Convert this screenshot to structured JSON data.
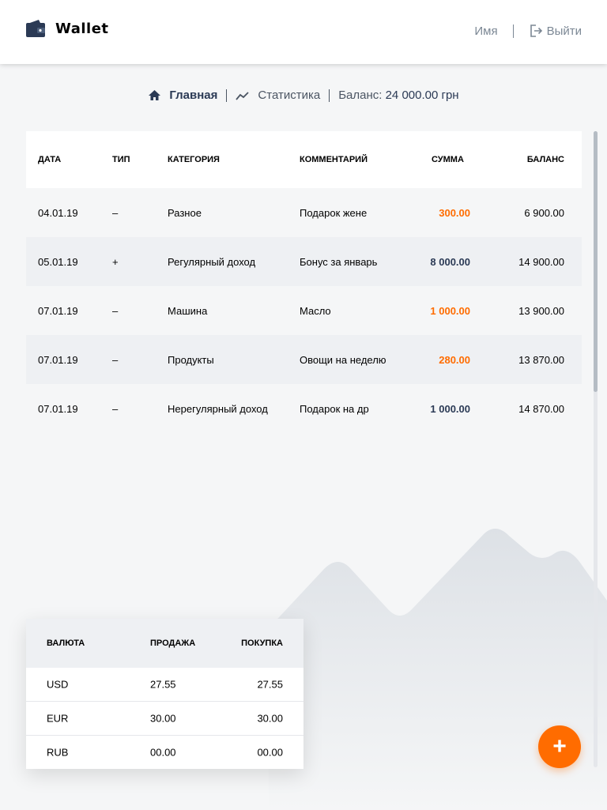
{
  "header": {
    "logo_text": "Wallet",
    "user_name": "Имя",
    "logout_label": "Выйти"
  },
  "nav": {
    "home_label": "Главная",
    "stats_label": "Статистика",
    "balance_label": "Баланс:",
    "balance_value": "24 000.00 грн"
  },
  "transactions": {
    "headers": [
      "Дата",
      "Тип",
      "Категория",
      "Комментарий",
      "Сумма",
      "Баланс"
    ],
    "rows": [
      {
        "date": "04.01.19",
        "type": "–",
        "category": "Разное",
        "comment": "Подарок жене",
        "sum": "300.00",
        "kind": "expense",
        "balance": "6 900.00"
      },
      {
        "date": "05.01.19",
        "type": "+",
        "category": "Регулярный доход",
        "comment": "Бонус за январь",
        "sum": "8 000.00",
        "kind": "income",
        "balance": "14 900.00"
      },
      {
        "date": "07.01.19",
        "type": "–",
        "category": "Машина",
        "comment": "Масло",
        "sum": "1 000.00",
        "kind": "expense",
        "balance": "13 900.00"
      },
      {
        "date": "07.01.19",
        "type": "–",
        "category": "Продукты",
        "comment": "Овощи на неделю",
        "sum": "280.00",
        "kind": "expense",
        "balance": "13 870.00"
      },
      {
        "date": "07.01.19",
        "type": "–",
        "category": "Нерегулярный доход",
        "comment": "Подарок на др",
        "sum": "1 000.00",
        "kind": "income",
        "balance": "14 870.00"
      }
    ]
  },
  "currency": {
    "headers": [
      "Валюта",
      "Продажа",
      "Покупка"
    ],
    "rows": [
      {
        "name": "USD",
        "sell": "27.55",
        "buy": "27.55"
      },
      {
        "name": "EUR",
        "sell": "30.00",
        "buy": "30.00"
      },
      {
        "name": "RUB",
        "sell": "00.00",
        "buy": "00.00"
      }
    ]
  },
  "add_button": {
    "label": "+"
  },
  "colors": {
    "accent": "#ff6c00",
    "navy": "#2b3a55",
    "row_alt": "#eef0f3",
    "background": "#f5f6f7"
  },
  "icons": [
    "wallet-icon",
    "logout-icon",
    "home-icon",
    "chart-line-icon",
    "plus-icon"
  ]
}
